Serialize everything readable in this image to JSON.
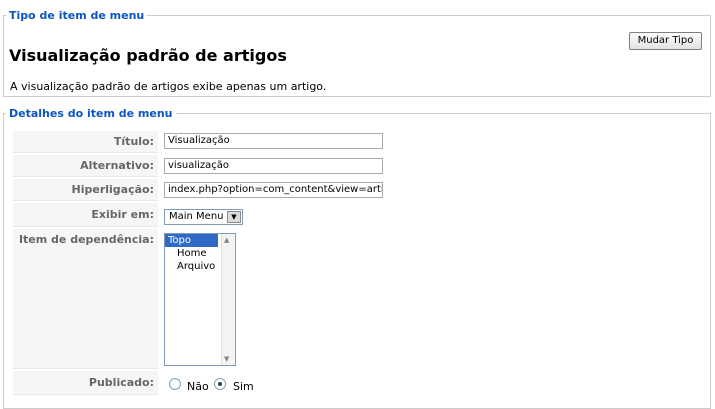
{
  "type_section": {
    "legend": "Tipo de item de menu",
    "heading": "Visualização padrão de artigos",
    "description": "A visualização padrão de artigos exibe apenas um artigo.",
    "change_button": "Mudar Tipo"
  },
  "details_section": {
    "legend": "Detalhes do item de menu",
    "title_label": "Título:",
    "title_value": "Visualização",
    "alias_label": "Alternativo:",
    "alias_value": "visualização",
    "link_label": "Hiperligação:",
    "link_value": "index.php?option=com_content&view=article",
    "menu_label": "Exibir em:",
    "menu_value": "Main Menu",
    "parent_label": "Item de dependência:",
    "parent_options": [
      "Topo",
      "Home",
      "Arquivo"
    ],
    "parent_selected": "Topo",
    "published_label": "Publicado:",
    "published_no": "Não",
    "published_yes": "Sim",
    "published_value": "Sim"
  }
}
